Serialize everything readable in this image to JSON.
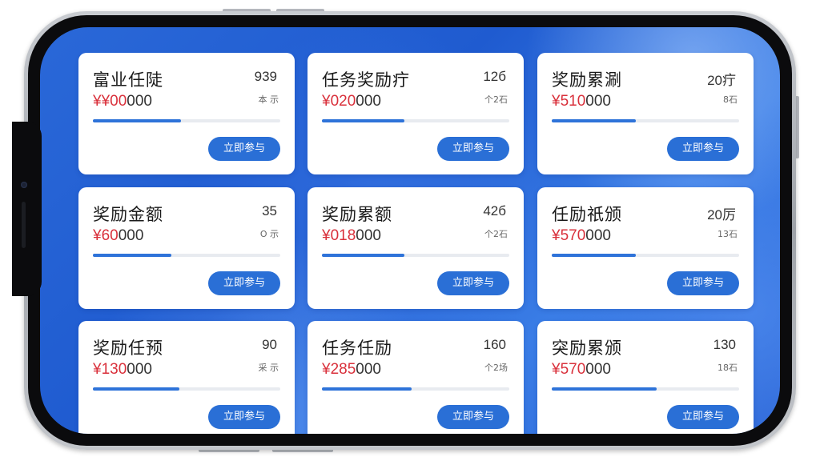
{
  "cards": [
    {
      "title": "富业任陡",
      "amount_prefix": "¥¥00",
      "amount_suffix": "000",
      "meta_top": "939",
      "meta_bottom": "本 示",
      "progress": 0.47,
      "button": "立即参与"
    },
    {
      "title": "任务奖励疔",
      "amount_prefix": "¥020",
      "amount_suffix": "000",
      "meta_top": "12б",
      "meta_bottom": "个2石",
      "progress": 0.44,
      "button": "立即参与"
    },
    {
      "title": "奖励累涮",
      "amount_prefix": "¥510",
      "amount_suffix": "000",
      "meta_top": "20疔",
      "meta_bottom": "8石",
      "progress": 0.45,
      "button": "立即参与"
    },
    {
      "title": "奖励金额",
      "amount_prefix": "¥60",
      "amount_suffix": "000",
      "meta_top": "35",
      "meta_bottom": "O 示",
      "progress": 0.42,
      "button": "立即参与"
    },
    {
      "title": "奖励累额",
      "amount_prefix": "¥018",
      "amount_suffix": "000",
      "meta_top": "42б",
      "meta_bottom": "个2石",
      "progress": 0.44,
      "button": "立即参与"
    },
    {
      "title": "任励祇颁",
      "amount_prefix": "¥570",
      "amount_suffix": "000",
      "meta_top": "20厉",
      "meta_bottom": "13石",
      "progress": 0.45,
      "button": "立即参与"
    },
    {
      "title": "奖励任预",
      "amount_prefix": "¥130",
      "amount_suffix": "000",
      "meta_top": "90",
      "meta_bottom": "采 示",
      "progress": 0.46,
      "button": "立即参与"
    },
    {
      "title": "任务任励",
      "amount_prefix": "¥285",
      "amount_suffix": "000",
      "meta_top": "160",
      "meta_bottom": "个2场",
      "progress": 0.48,
      "button": "立即参与"
    },
    {
      "title": "突励累颁",
      "amount_prefix": "¥570",
      "amount_suffix": "000",
      "meta_top": "130",
      "meta_bottom": "18石",
      "progress": 0.56,
      "button": "立即参与"
    }
  ],
  "colors": {
    "accent": "#2a6fd6",
    "amount_red": "#d9303b",
    "card_bg": "#ffffff",
    "screen_bg": "#2563d6"
  }
}
